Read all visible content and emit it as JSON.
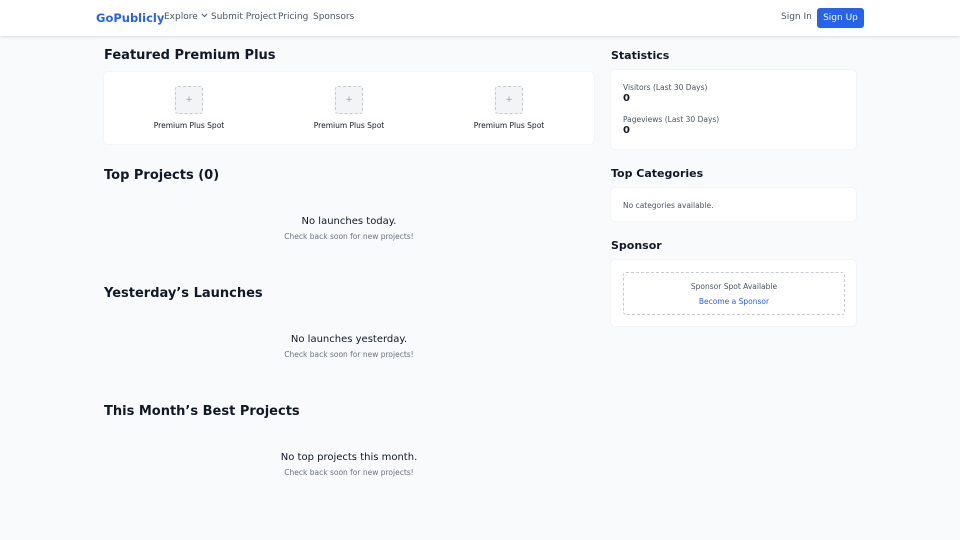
{
  "header": {
    "logo": "GoPublicly",
    "nav": {
      "explore": "Explore",
      "submit": "Submit Project",
      "pricing": "Pricing",
      "sponsors": "Sponsors"
    },
    "sign_in": "Sign In",
    "sign_up": "Sign Up"
  },
  "featured": {
    "title": "Featured Premium Plus",
    "spots": [
      {
        "icon": "+",
        "label": "Premium Plus Spot"
      },
      {
        "icon": "+",
        "label": "Premium Plus Spot"
      },
      {
        "icon": "+",
        "label": "Premium Plus Spot"
      }
    ]
  },
  "top_projects": {
    "title": "Top Projects (0)",
    "empty_title": "No launches today.",
    "empty_sub": "Check back soon for new projects!"
  },
  "yesterday": {
    "title": "Yesterday’s Launches",
    "empty_title": "No launches yesterday.",
    "empty_sub": "Check back soon for new projects!"
  },
  "month_best": {
    "title": "This Month’s Best Projects",
    "empty_title": "No top projects this month.",
    "empty_sub": "Check back soon for new projects!"
  },
  "statistics": {
    "title": "Statistics",
    "visitors_label": "Visitors (Last 30 Days)",
    "visitors_value": "0",
    "pageviews_label": "Pageviews (Last 30 Days)",
    "pageviews_value": "0"
  },
  "categories": {
    "title": "Top Categories",
    "empty": "No categories available."
  },
  "sponsor": {
    "title": "Sponsor",
    "box_title": "Sponsor Spot Available",
    "link": "Become a Sponsor"
  },
  "colors": {
    "accent": "#2563eb",
    "background": "#f9fafb"
  }
}
